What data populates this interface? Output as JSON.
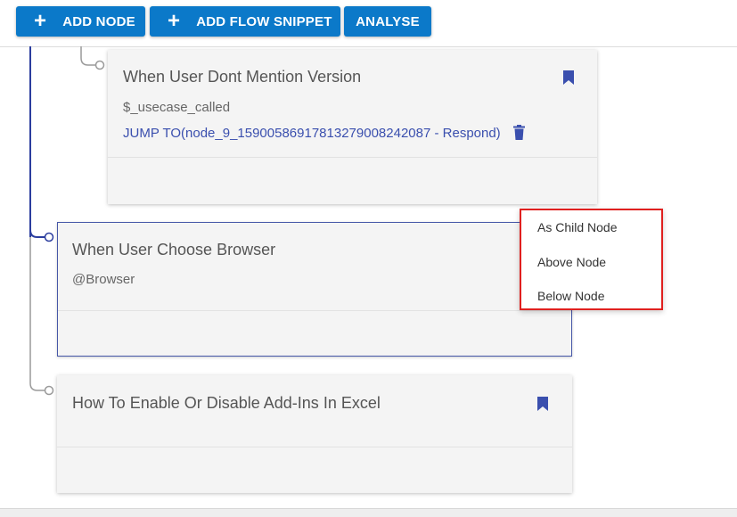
{
  "toolbar": {
    "add_node": "ADD NODE",
    "add_flow_snippet": "ADD FLOW SNIPPET",
    "analyse": "ANALYSE"
  },
  "nodes": [
    {
      "title": "When User Dont Mention Version",
      "condition": "$_usecase_called",
      "jump": "JUMP TO(node_9_15900586917813279008242087 - Respond)"
    },
    {
      "title": "When User Choose Browser",
      "condition": "@Browser"
    },
    {
      "title": "How To Enable Or Disable Add-Ins In Excel"
    }
  ],
  "context_menu": {
    "items": [
      "As Child Node",
      "Above Node",
      "Below Node"
    ]
  },
  "colors": {
    "primary_button": "#0b79c9",
    "accent_blue": "#3a4fae",
    "tree_line": "#2b3d9e",
    "highlight_border": "#e0201f"
  }
}
